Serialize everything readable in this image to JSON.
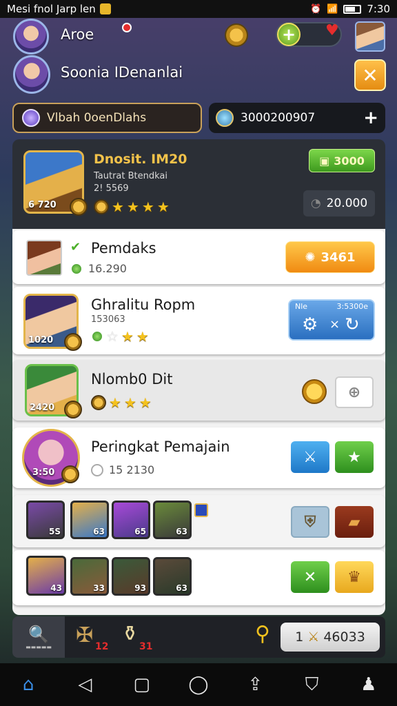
{
  "status_bar": {
    "app_title": "Mesi fnol Jarp len",
    "time": "7:30"
  },
  "header": {
    "player1_name": "Aroe",
    "player2_name": "Soonia IDenanlai",
    "heart_icon": "heart-icon",
    "add_icon": "plus-icon",
    "close_label": "✕"
  },
  "tabs": {
    "left_label": "Vlbah 0oenDlahs",
    "right_value": "3000200907",
    "right_action": "+"
  },
  "featured": {
    "title": "Dnosit. IM20",
    "subtitle": "Tautrat Btendkai",
    "subvalue": "2! 5569",
    "thumb_label": "6 720",
    "green_button": "3000",
    "dark_button": "20.000",
    "stars": 4
  },
  "list": {
    "rows": [
      {
        "name": "Pemdaks",
        "value": "16.290",
        "action": "3461"
      },
      {
        "name": "Ghralitu Ropm",
        "value": "153063",
        "panel_left": "Nle",
        "panel_right": "3:5300e",
        "thumb_label": "1020"
      },
      {
        "name": "Nlomb0 Dit",
        "thumb_label": "2420"
      },
      {
        "name": "Peringkat Pemajain",
        "value": "15 2130",
        "thumb_label": "3:50"
      }
    ],
    "team_row1_levels": [
      "5S",
      "63",
      "65",
      "63"
    ],
    "team_row2_levels": [
      "43",
      "33",
      "93",
      "63"
    ]
  },
  "bottom_bar": {
    "search_caption": "▬▬▬▬▬",
    "item1_count": "12",
    "item2_count": "31",
    "score": "46033",
    "score_prefix": "1"
  },
  "colors": {
    "accent_gold": "#f2c24a",
    "accent_orange": "#f08a12",
    "accent_green": "#3e9a1e",
    "accent_blue": "#2a6fc0"
  }
}
